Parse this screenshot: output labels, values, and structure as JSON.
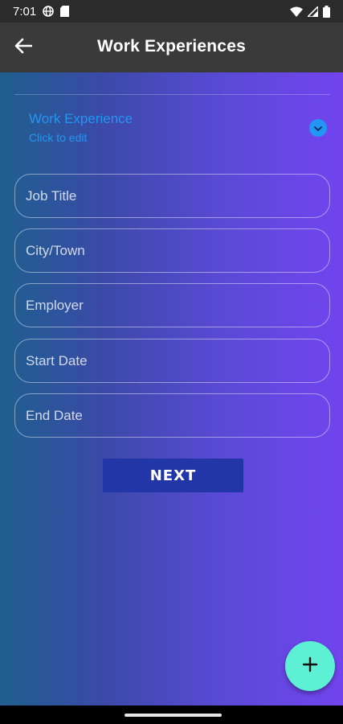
{
  "status_bar": {
    "time": "7:01",
    "left_icons": [
      "globe-icon",
      "sim-card-icon"
    ],
    "right_icons": [
      "wifi-icon",
      "signal-icon",
      "battery-icon"
    ]
  },
  "app_bar": {
    "title": "Work Experiences",
    "back_icon": "arrow-left-icon"
  },
  "section": {
    "title": "Work Experience",
    "subtitle": "Click to edit",
    "toggle_icon": "chevron-down-icon"
  },
  "form": {
    "job_title_placeholder": "Job Title",
    "city_placeholder": "City/Town",
    "employer_placeholder": "Employer",
    "start_date_placeholder": "Start Date",
    "end_date_placeholder": "End Date",
    "next_label": "NEXT"
  },
  "fab": {
    "icon": "plus-icon"
  },
  "colors": {
    "accent_blue": "#2196f3",
    "button_blue": "#2336a8",
    "fab_color": "#5ef0d5",
    "gradient_start": "#1e5f8e",
    "gradient_end": "#7244ef"
  }
}
